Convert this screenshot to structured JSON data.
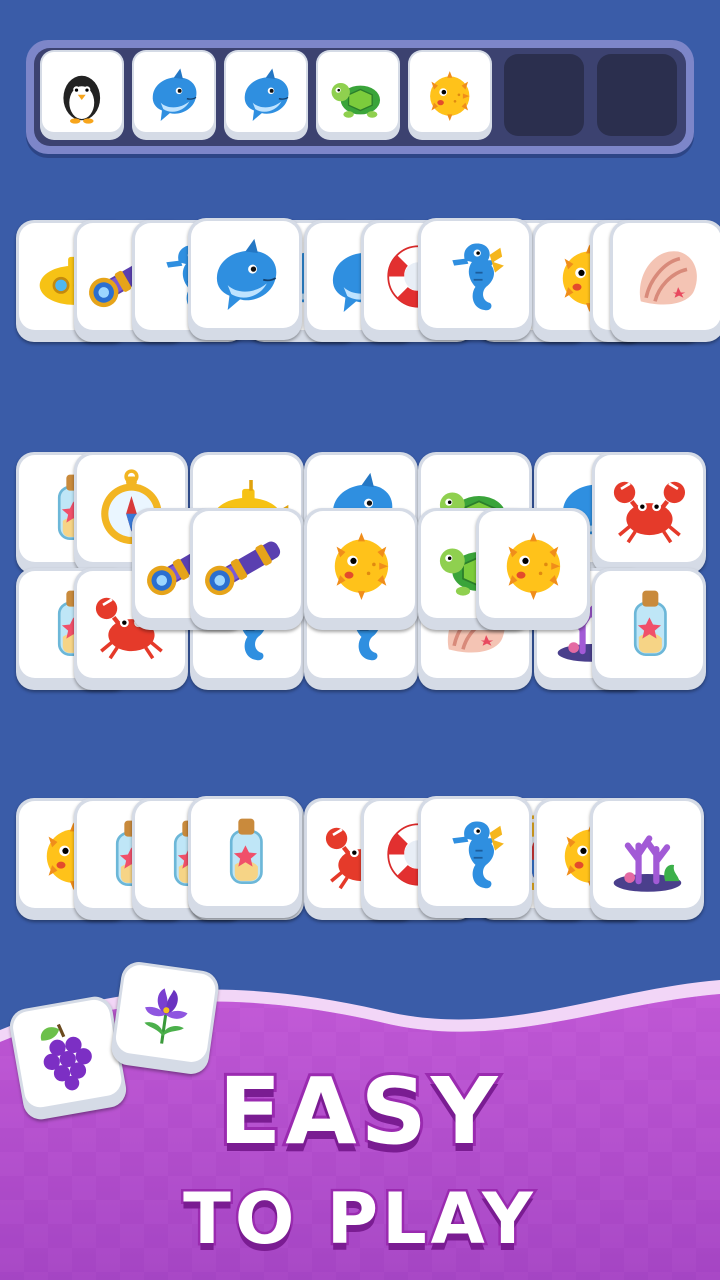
{
  "tray": {
    "slots": [
      "penguin-icon",
      "dolphin-icon",
      "dolphin-icon",
      "turtle-icon",
      "pufferfish-icon",
      "",
      ""
    ]
  },
  "board": {
    "row1_back": [
      "submarine-icon",
      "telescope-icon",
      "seahorse-icon",
      "dolphin-icon",
      "dolphin-icon",
      "lifebuoy-icon",
      "pufferfish-icon",
      "pufferfish-icon",
      "turtle-icon",
      "shell-icon"
    ],
    "row1_front": [
      "dolphin-icon",
      "seahorse-icon"
    ],
    "row2_back": [
      "bottle-icon",
      "compass-icon",
      "submarine-icon",
      "dolphin-icon",
      "turtle-icon",
      "dolphin-icon",
      "crab-icon"
    ],
    "row2_low": [
      "bottle-icon",
      "crab-icon",
      "seahorse-icon",
      "seahorse-icon",
      "shell-icon",
      "coral-icon",
      "bottle-icon"
    ],
    "row2_front": [
      "telescope-icon",
      "telescope-icon",
      "pufferfish-icon",
      "turtle-icon",
      "pufferfish-icon"
    ],
    "row3_back": [
      "pufferfish-icon",
      "bottle-icon",
      "bottle-icon",
      "bottle-icon",
      "crab-icon",
      "lifebuoy-icon",
      "compass-icon",
      "pufferfish-icon",
      "coral-icon"
    ],
    "row3_front": [
      "bottle-icon",
      "seahorse-icon"
    ]
  },
  "banner": {
    "line1": "EASY",
    "line2": "TO PLAY",
    "deco_tiles": [
      "grapes-icon",
      "iris-flower-icon"
    ]
  },
  "colors": {
    "background": "#3a5ca8",
    "banner_purple": "#b94fd0",
    "text_outline": "#9a2bb0"
  }
}
